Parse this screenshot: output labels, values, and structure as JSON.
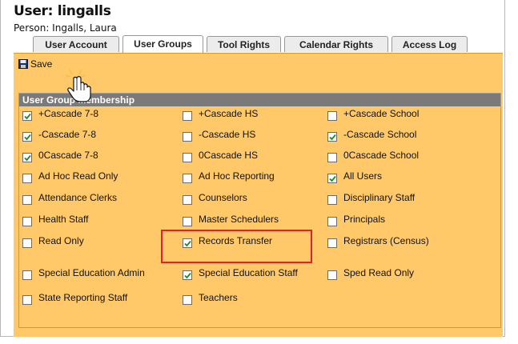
{
  "header": {
    "title": "User: lingalls",
    "person": "Person: Ingalls, Laura"
  },
  "tabs": [
    {
      "label": "User Account",
      "active": false
    },
    {
      "label": "User Groups",
      "active": true
    },
    {
      "label": "Tool Rights",
      "active": false
    },
    {
      "label": "Calendar Rights",
      "active": false
    },
    {
      "label": "Access Log",
      "active": false
    }
  ],
  "toolbar": {
    "save_label": "Save"
  },
  "group": {
    "heading": "User Group Membership",
    "items": [
      {
        "label": "+Cascade 7-8",
        "checked": true
      },
      {
        "label": "+Cascade HS",
        "checked": false
      },
      {
        "label": "+Cascade School",
        "checked": false
      },
      {
        "label": "-Cascade 7-8",
        "checked": true
      },
      {
        "label": "-Cascade HS",
        "checked": false
      },
      {
        "label": "-Cascade School",
        "checked": true
      },
      {
        "label": "0Cascade 7-8",
        "checked": true
      },
      {
        "label": "0Cascade HS",
        "checked": false
      },
      {
        "label": "0Cascade School",
        "checked": false
      },
      {
        "label": "Ad Hoc Read Only",
        "checked": false
      },
      {
        "label": "Ad Hoc Reporting",
        "checked": false
      },
      {
        "label": "All Users",
        "checked": true
      },
      {
        "label": "Attendance Clerks",
        "checked": false
      },
      {
        "label": "Counselors",
        "checked": false
      },
      {
        "label": "Disciplinary Staff",
        "checked": false
      },
      {
        "label": "Health Staff",
        "checked": false
      },
      {
        "label": "Master Schedulers",
        "checked": false
      },
      {
        "label": "Principals",
        "checked": false
      },
      {
        "label": "Read Only",
        "checked": false
      },
      {
        "label": "Records Transfer",
        "checked": true
      },
      {
        "label": "Registrars (Census)",
        "checked": false
      },
      {
        "label": "Special Education Admin",
        "checked": false
      },
      {
        "label": "Special Education Staff",
        "checked": true
      },
      {
        "label": "Sped Read Only",
        "checked": false
      },
      {
        "label": "State Reporting Staff",
        "checked": false
      },
      {
        "label": "Teachers",
        "checked": false
      }
    ]
  },
  "colors": {
    "panel": "#ffc868",
    "group_header": "#7a7a7a",
    "highlight": "#e6202a",
    "check": "#1f8a2b"
  }
}
